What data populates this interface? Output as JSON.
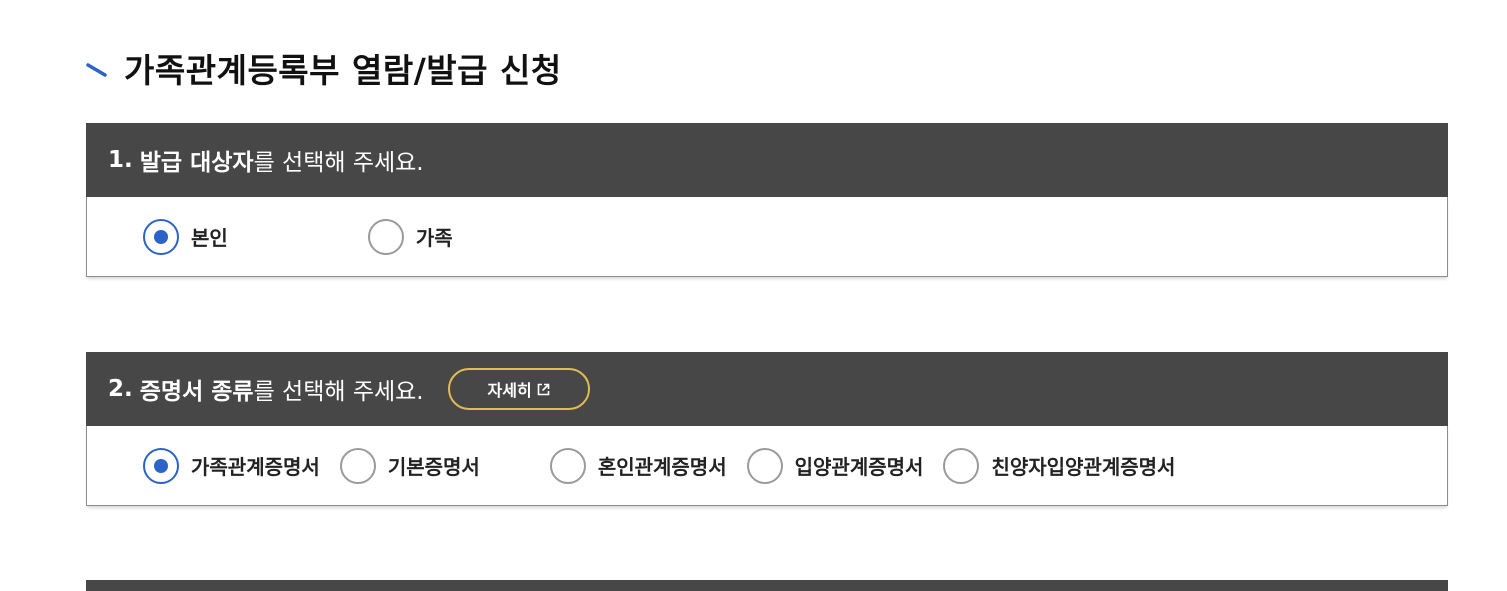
{
  "page": {
    "title": "가족관계등록부 열람/발급 신청"
  },
  "section1": {
    "number": "1.",
    "strong": "발급 대상자",
    "rest": "를 선택해 주세요.",
    "options": [
      "본인",
      "가족"
    ],
    "selected": "본인"
  },
  "section2": {
    "number": "2.",
    "strong": "증명서 종류",
    "rest": "를 선택해 주세요.",
    "detail_button": "자세히",
    "options": [
      "가족관계증명서",
      "기본증명서",
      "혼인관계증명서",
      "입양관계증명서",
      "친양자입양관계증명서"
    ],
    "selected": "가족관계증명서"
  },
  "colors": {
    "header_bg": "#474747",
    "radio_selected": "#2b63c9",
    "detail_border": "#e3bb50",
    "title_mark": "#2b63c9"
  },
  "icons": {
    "title_mark": "diagonal-stroke-icon",
    "detail": "external-link-icon"
  }
}
